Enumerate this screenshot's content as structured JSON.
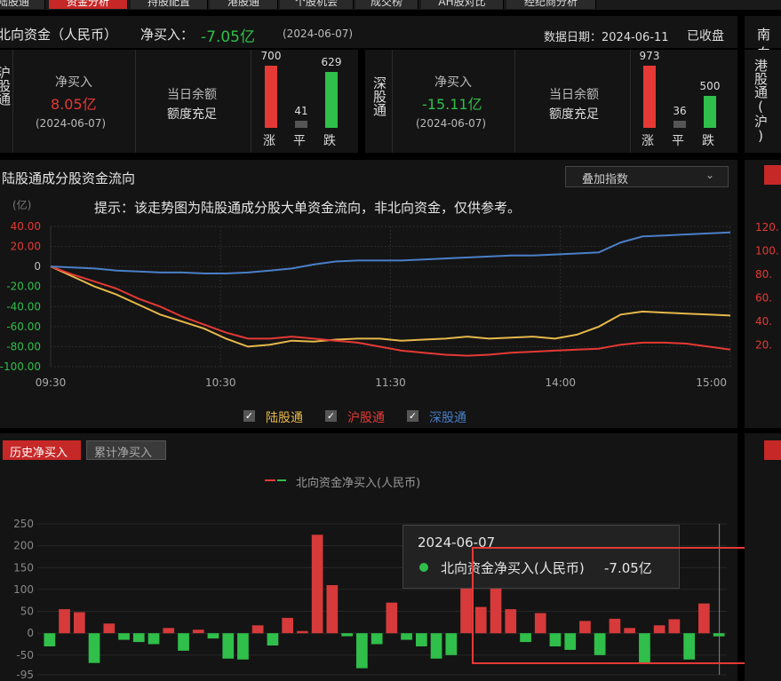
{
  "tabs": [
    "陆股通",
    "资金分析",
    "持股配置",
    "港股通",
    "个股机会",
    "成交榜",
    "AH股对比",
    "经纪商分析"
  ],
  "header": {
    "title": "北向资金（人民币）",
    "net_label": "净买入：",
    "net_value": "-7.05亿",
    "net_date": "(2024-06-07)",
    "data_date": "数据日期：2024-06-11",
    "status": "已收盘",
    "right_title": "南向"
  },
  "hgt": {
    "name": "沪股通",
    "net_label": "净买入",
    "net_value": "8.05亿",
    "date": "(2024-06-07)",
    "quota_label": "当日余额",
    "quota_value": "额度充足",
    "bars": [
      {
        "label": "涨",
        "value": "700",
        "level": 1.0,
        "color": "#e53935"
      },
      {
        "label": "平",
        "value": "41",
        "level": 0.12,
        "color": "#555"
      },
      {
        "label": "跌",
        "value": "629",
        "level": 0.9,
        "color": "#2fbf4a"
      }
    ]
  },
  "sgt": {
    "name": "深股通",
    "net_label": "净买入",
    "net_value": "-15.11亿",
    "date": "(2024-06-07)",
    "quota_label": "当日余额",
    "quota_value": "额度充足",
    "bars": [
      {
        "label": "涨",
        "value": "973",
        "level": 1.0,
        "color": "#e53935"
      },
      {
        "label": "平",
        "value": "36",
        "level": 0.12,
        "color": "#555"
      },
      {
        "label": "跌",
        "value": "500",
        "level": 0.52,
        "color": "#2fbf4a"
      }
    ]
  },
  "south": {
    "name": "港股通(沪)"
  },
  "flow": {
    "title": "陆股通成分股资金流向",
    "dropdown": "叠加指数",
    "tip": "提示：该走势图为陆股通成分股大单资金流向，非北向资金，仅供参考。",
    "unit": "(亿)",
    "legend": [
      {
        "label": "陆股通",
        "color": "#e6b84a",
        "checked": true
      },
      {
        "label": "沪股通",
        "color": "#e53935",
        "checked": true
      },
      {
        "label": "深股通",
        "color": "#4a7fc8",
        "checked": true
      }
    ],
    "right_ticks": [
      "120.",
      "100.",
      "80.",
      "60.",
      "40.",
      "20."
    ]
  },
  "chart_data": [
    {
      "type": "line",
      "title": "陆股通成分股资金流向",
      "ylabel": "(亿)",
      "ylim": [
        -100,
        40
      ],
      "y_ticks": [
        "40.00",
        "20.00",
        "0",
        "-20.00",
        "-40.00",
        "-60.00",
        "-80.00",
        "-100.00"
      ],
      "x_ticks": [
        "09:30",
        "10:30",
        "11:30",
        "14:00",
        "15:00"
      ],
      "x_index": [
        0,
        0.25,
        0.5,
        0.75,
        1.0
      ],
      "series": [
        {
          "name": "陆股通",
          "color": "#e6b84a",
          "values": [
            0,
            -10,
            -20,
            -28,
            -38,
            -48,
            -55,
            -62,
            -72,
            -80,
            -78,
            -74,
            -75,
            -73,
            -72,
            -72,
            -74,
            -73,
            -72,
            -70,
            -72,
            -71,
            -70,
            -72,
            -68,
            -60,
            -48,
            -45,
            -46,
            -47,
            -48,
            -49
          ]
        },
        {
          "name": "沪股通",
          "color": "#e53935",
          "values": [
            0,
            -8,
            -15,
            -22,
            -32,
            -40,
            -50,
            -58,
            -66,
            -72,
            -72,
            -70,
            -72,
            -74,
            -76,
            -80,
            -84,
            -86,
            -88,
            -89,
            -88,
            -86,
            -85,
            -84,
            -83,
            -82,
            -78,
            -76,
            -76,
            -77,
            -80,
            -83
          ]
        },
        {
          "name": "深股通",
          "color": "#4a7fc8",
          "values": [
            0,
            -1,
            -2,
            -4,
            -5,
            -6,
            -6,
            -7,
            -7,
            -6,
            -4,
            -2,
            2,
            5,
            6,
            6,
            6,
            7,
            8,
            9,
            10,
            11,
            11,
            12,
            13,
            14,
            24,
            30,
            31,
            32,
            33,
            34
          ]
        }
      ]
    },
    {
      "type": "bar",
      "title": "北向资金净买入(人民币)",
      "legend": "北向资金净买入(人民币)",
      "tabs": [
        "历史净买入",
        "累计净买入"
      ],
      "ylim": [
        -95,
        250
      ],
      "y_ticks": [
        "250",
        "200",
        "150",
        "100",
        "50",
        "0",
        "-50",
        "-95"
      ],
      "values": [
        -30,
        55,
        48,
        -68,
        22,
        -15,
        -20,
        -25,
        12,
        -40,
        8,
        -12,
        -58,
        -60,
        18,
        -28,
        35,
        5,
        225,
        110,
        -7,
        -80,
        -25,
        70,
        -15,
        -30,
        -58,
        -50,
        118,
        60,
        126,
        55,
        -20,
        46,
        -30,
        -38,
        28,
        -50,
        33,
        12,
        -70,
        18,
        32,
        -60,
        68,
        -7.05
      ],
      "tooltip": {
        "date": "2024-06-07",
        "series": "北向资金净买入(人民币)",
        "value": "-7.05亿"
      }
    }
  ]
}
